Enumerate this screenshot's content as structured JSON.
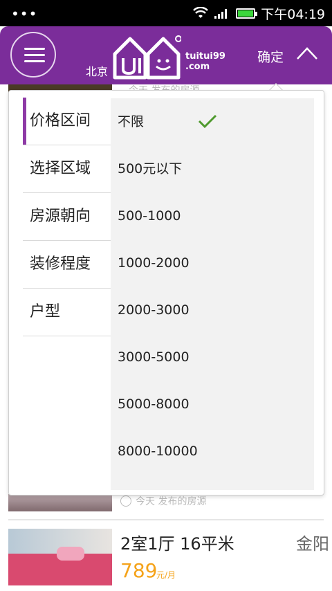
{
  "status_bar": {
    "dots": "•••",
    "time": "下午04:19",
    "battery_level": 1.0,
    "icons": [
      "wifi-icon",
      "signal-icon",
      "battery-icon"
    ]
  },
  "header": {
    "city": "北京",
    "logo_text_line1": "tuitui99",
    "logo_text_line2": ".com",
    "confirm_label": "确定",
    "background_color": "#7b2d9a"
  },
  "background_list": {
    "top_partial_text": "今天 发布的房源",
    "mid_partial_text": "今天 发布的房源",
    "listing": {
      "title": "2室1厅 16平米",
      "district": "金阳",
      "price": "789",
      "price_unit": "元/月"
    }
  },
  "filter": {
    "categories": [
      {
        "label": "价格区间",
        "active": true
      },
      {
        "label": "选择区域",
        "active": false
      },
      {
        "label": "房源朝向",
        "active": false
      },
      {
        "label": "装修程度",
        "active": false
      },
      {
        "label": "户型",
        "active": false
      }
    ],
    "options": [
      {
        "label": "不限",
        "selected": true
      },
      {
        "label": "500元以下",
        "selected": false
      },
      {
        "label": "500-1000",
        "selected": false
      },
      {
        "label": "1000-2000",
        "selected": false
      },
      {
        "label": "2000-3000",
        "selected": false
      },
      {
        "label": "3000-5000",
        "selected": false
      },
      {
        "label": "5000-8000",
        "selected": false
      },
      {
        "label": "8000-10000",
        "selected": false
      }
    ],
    "accent_color": "#8e3aa6",
    "check_color": "#4f9a2e"
  }
}
